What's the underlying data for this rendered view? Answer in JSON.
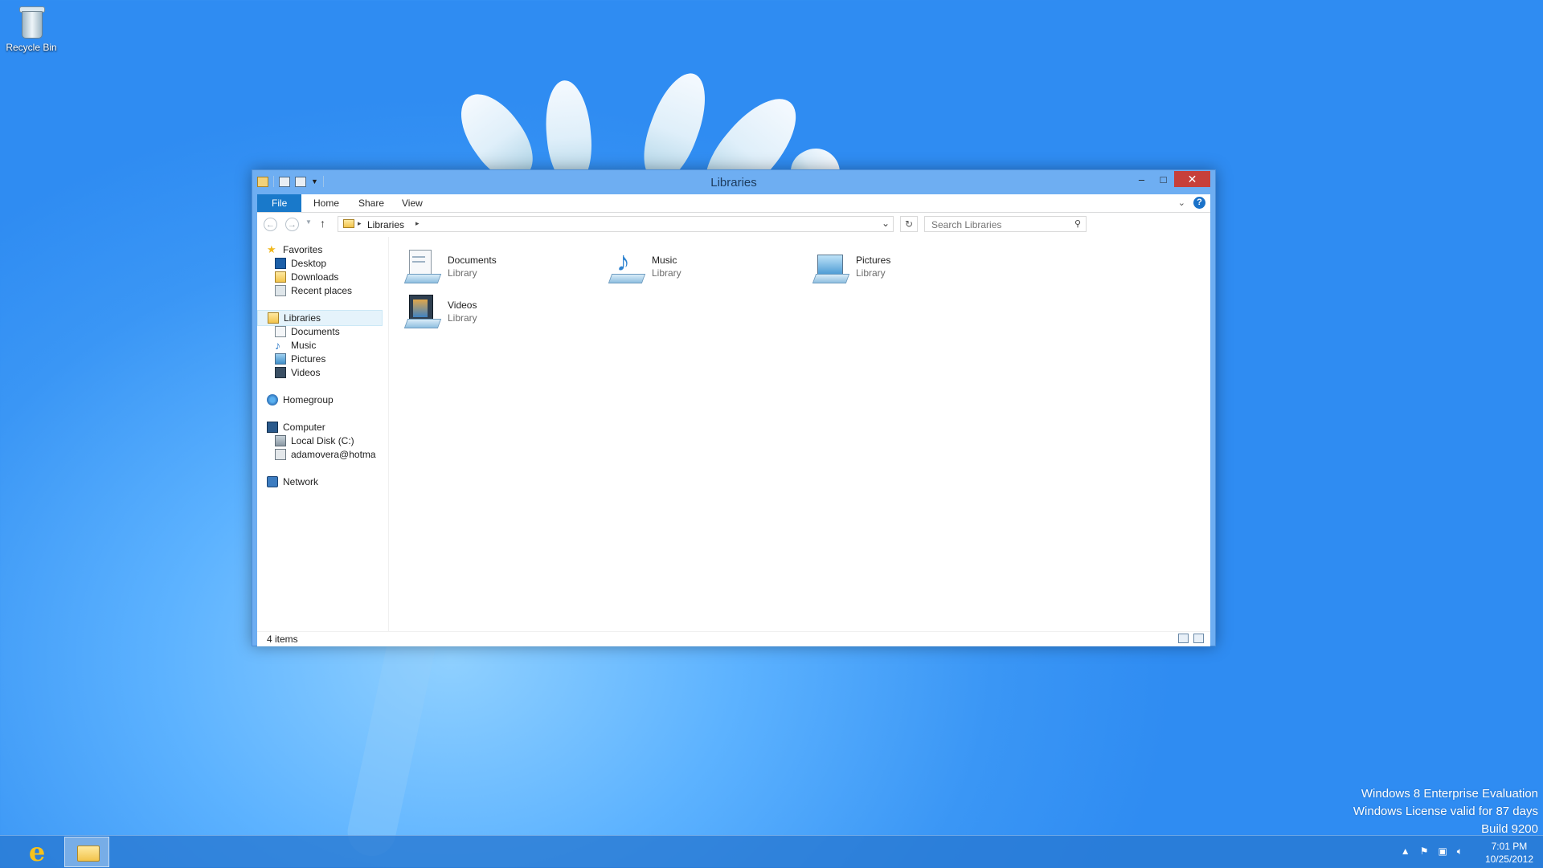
{
  "desktop": {
    "recycle_bin_label": "Recycle Bin"
  },
  "window": {
    "title": "Libraries",
    "minimize_glyph": "–",
    "maximize_glyph": "□",
    "close_glyph": "✕"
  },
  "ribbon": {
    "tabs": [
      {
        "label": "File"
      },
      {
        "label": "Home"
      },
      {
        "label": "Share"
      },
      {
        "label": "View"
      }
    ],
    "help_glyph": "?"
  },
  "address": {
    "crumb": "Libraries",
    "search_placeholder": "Search Libraries"
  },
  "nav": {
    "favorites": {
      "label": "Favorites",
      "items": [
        {
          "label": "Desktop"
        },
        {
          "label": "Downloads"
        },
        {
          "label": "Recent places"
        }
      ]
    },
    "libraries": {
      "label": "Libraries",
      "items": [
        {
          "label": "Documents"
        },
        {
          "label": "Music"
        },
        {
          "label": "Pictures"
        },
        {
          "label": "Videos"
        }
      ]
    },
    "homegroup": {
      "label": "Homegroup"
    },
    "computer": {
      "label": "Computer",
      "items": [
        {
          "label": "Local Disk (C:)"
        },
        {
          "label": "adamovera@hotma"
        }
      ]
    },
    "network": {
      "label": "Network"
    }
  },
  "content": {
    "items": [
      {
        "name": "Documents",
        "type": "Library"
      },
      {
        "name": "Music",
        "type": "Library"
      },
      {
        "name": "Pictures",
        "type": "Library"
      },
      {
        "name": "Videos",
        "type": "Library"
      }
    ]
  },
  "status": {
    "item_count": "4 items"
  },
  "watermark": {
    "line1": "Windows 8 Enterprise Evaluation",
    "line2": "Windows License valid for 87 days",
    "line3": "Build 9200"
  },
  "taskbar": {
    "time": "7:01 PM",
    "date": "10/25/2012"
  },
  "colors": {
    "accent": "#1979ca",
    "close": "#c7403a",
    "window_frame": "#6eaef2"
  }
}
